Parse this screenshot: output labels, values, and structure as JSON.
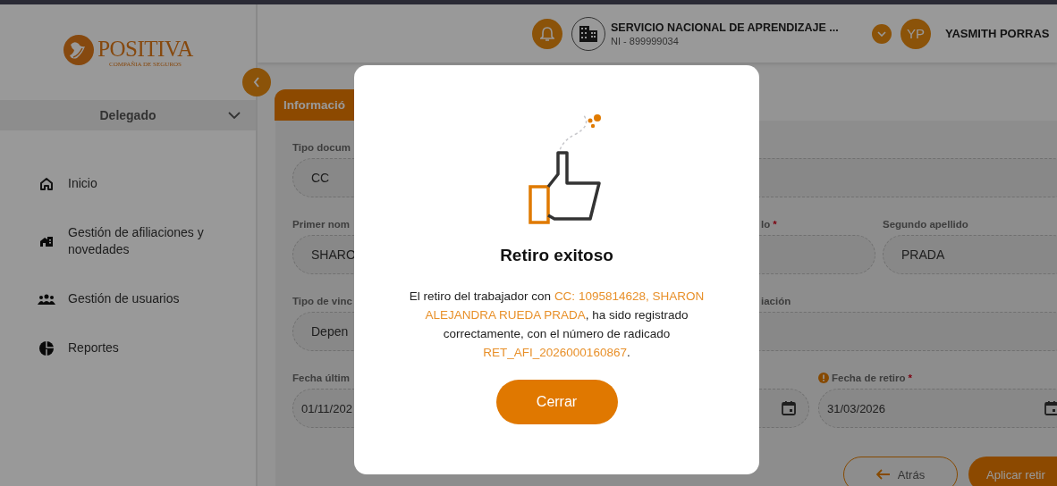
{
  "sidebar": {
    "logo": {
      "name": "POSITIVA",
      "tagline": "COMPAÑIA DE SEGUROS"
    },
    "role": "Delegado",
    "items": [
      {
        "label": "Inicio",
        "kind": "home"
      },
      {
        "label": "Gestión de afiliaciones y novedades",
        "kind": "houses"
      },
      {
        "label": "Gestión de usuarios",
        "kind": "users"
      },
      {
        "label": "Reportes",
        "kind": "chart"
      }
    ]
  },
  "header": {
    "company": "SERVICIO NACIONAL DE APRENDIZAJE ...",
    "company_id": "NI - 899999034",
    "avatar": "YP",
    "user": "YASMITH PORRAS"
  },
  "tabs": [
    {
      "label": "Informació",
      "selected": true
    }
  ],
  "form": {
    "rows": [
      [
        {
          "label": "Tipo docum",
          "value": "CC",
          "kind": "text"
        }
      ],
      [
        {
          "label": "Primer nom",
          "value": "SHARO",
          "kind": "text"
        },
        {
          "label": "lo",
          "required_mark": "*",
          "kind": "text"
        },
        {
          "label": "Segundo apellido",
          "value": "PRADA",
          "kind": "text"
        }
      ],
      [
        {
          "label": "Tipo de vinc",
          "value": "Depen",
          "kind": "text"
        },
        {
          "label": "iación",
          "kind": "text"
        }
      ],
      [
        {
          "label": "Fecha últim",
          "value": "01/11/202",
          "kind": "date",
          "warning": false
        },
        {
          "label": "Fecha de retiro",
          "value": "31/03/2026",
          "required_mark": "*",
          "warning": true,
          "kind": "date"
        }
      ]
    ]
  },
  "actions": [
    {
      "label": "Atrás",
      "kind": "secondary"
    },
    {
      "label": "Aplicar retir",
      "kind": "primary"
    }
  ],
  "modal": {
    "title": "Retiro exitoso",
    "message": [
      {
        "text": "El retiro del trabajador con ",
        "highlight": false
      },
      {
        "text": "CC: 1095814628, SHARON ALEJANDRA RUEDA PRADA",
        "highlight": true
      },
      {
        "text": ", ha sido registrado correctamente, con el número de radicado ",
        "highlight": false
      },
      {
        "text": "RET_AFI_2026000160867",
        "highlight": true
      },
      {
        "text": ".",
        "highlight": false
      }
    ],
    "button": "Cerrar"
  }
}
